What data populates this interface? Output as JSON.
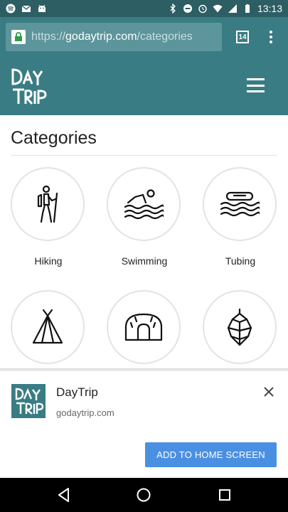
{
  "status_bar": {
    "time": "13:13",
    "left_icons": [
      "spotify-icon",
      "gmail-icon",
      "android-icon"
    ],
    "right_icons": [
      "bluetooth-icon",
      "do-not-disturb-icon",
      "alarm-icon",
      "wifi-icon",
      "signal-icon",
      "battery-icon"
    ]
  },
  "browser": {
    "url_scheme": "https://",
    "url_host": "godaytrip.com",
    "url_path": "/categories",
    "tab_count": "14"
  },
  "site": {
    "logo_text": "DayTrip",
    "page_title": "Categories",
    "colors": {
      "header": "#3a7c84",
      "accent_button": "#4a90e2"
    }
  },
  "categories": [
    {
      "label": "Hiking",
      "icon": "hiker-icon"
    },
    {
      "label": "Swimming",
      "icon": "swimmer-icon"
    },
    {
      "label": "Tubing",
      "icon": "tube-on-water-icon"
    },
    {
      "label": "",
      "icon": "tent-icon"
    },
    {
      "label": "",
      "icon": "cave-icon"
    },
    {
      "label": "",
      "icon": "hops-icon"
    }
  ],
  "install_banner": {
    "app_name": "DayTrip",
    "app_url": "godaytrip.com",
    "button_label": "ADD TO HOME SCREEN"
  }
}
